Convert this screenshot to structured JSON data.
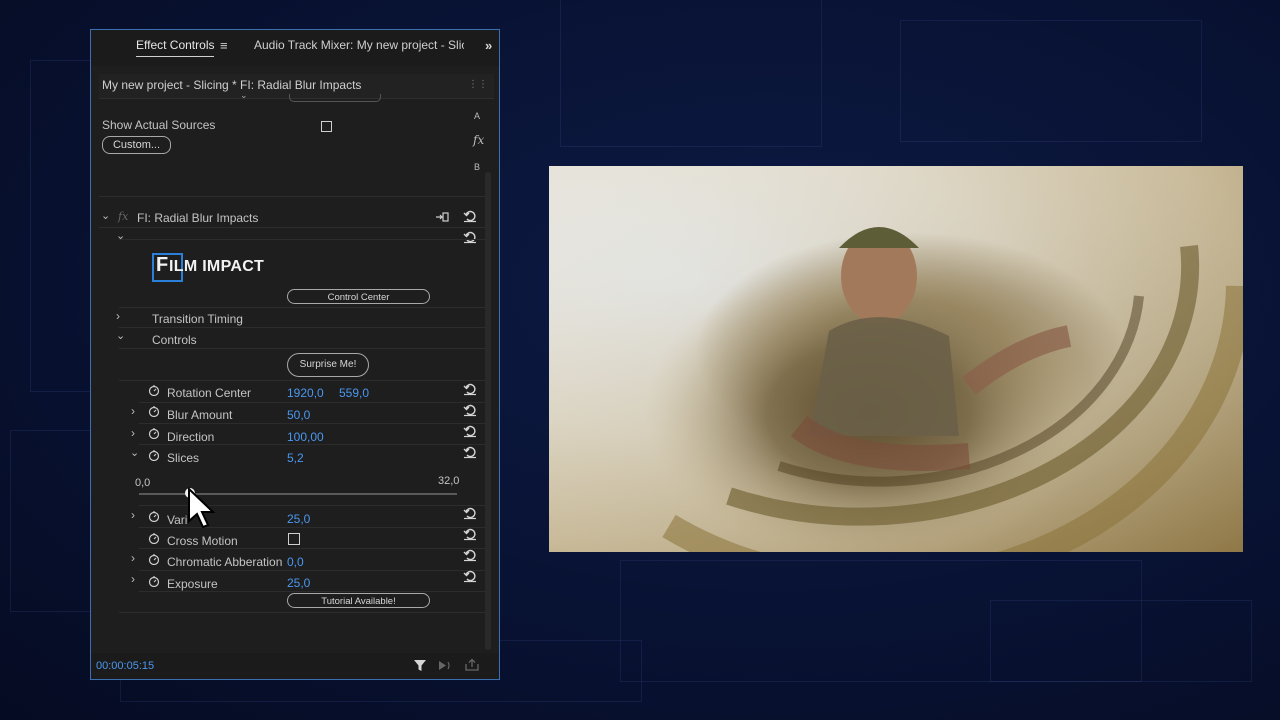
{
  "panel": {
    "tabs": {
      "effect_controls": "Effect Controls",
      "menu_icon": "≡",
      "audio_mixer": "Audio Track Mixer: My new project - Slicin",
      "overflow_icon": "»"
    },
    "clip_label": "My new project - Slicing * FI: Radial Blur Impacts",
    "ab": {
      "a": "A",
      "b": "B",
      "fx": "fx"
    },
    "show_actual_sources": {
      "label": "Show Actual Sources",
      "checked": false
    },
    "custom_button": "Custom...",
    "effect": {
      "fx_icon": "fx",
      "name": "FI: Radial Blur Impacts",
      "logo": {
        "prefix": "F",
        "text": "ILM IMPACT"
      },
      "control_center": "Control Center",
      "transition_timing": "Transition Timing",
      "controls": "Controls",
      "surprise": "Surprise Me!",
      "params": {
        "rotation_center": {
          "label": "Rotation Center",
          "x": "1920,0",
          "y": "559,0"
        },
        "blur_amount": {
          "label": "Blur Amount",
          "value": "50,0"
        },
        "direction": {
          "label": "Direction",
          "value": "100,00"
        },
        "slices": {
          "label": "Slices",
          "value": "5,2",
          "min": "0,0",
          "max": "32,0"
        },
        "variation": {
          "label": "Vari",
          "value": "25,0"
        },
        "cross_motion": {
          "label": "Cross Motion",
          "checked": false
        },
        "chromatic_abberation": {
          "label": "Chromatic Abberation",
          "value": "0,0"
        },
        "exposure": {
          "label": "Exposure",
          "value": "25,0"
        }
      },
      "tutorial": "Tutorial Available!"
    },
    "timecode": "00:00:05:15"
  },
  "colors": {
    "value_blue": "#4a98f0",
    "panel_bg": "#1e1e1e",
    "panel_border": "#3b6fb0"
  }
}
